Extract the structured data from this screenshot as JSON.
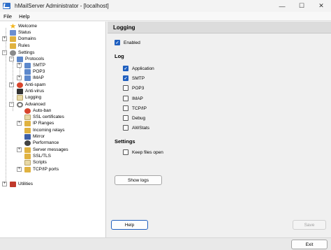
{
  "window": {
    "title": "hMailServer Administrator - [localhost]",
    "minimize": "—",
    "maximize": "☐",
    "close": "✕"
  },
  "menu": [
    "File",
    "Help"
  ],
  "tree": {
    "items": [
      {
        "label": "Welcome",
        "icon": "star-icon",
        "color": "#f2b51d"
      },
      {
        "label": "Status",
        "icon": "status-icon",
        "color": "#6c8fd0"
      },
      {
        "label": "Domains",
        "icon": "domains-icon",
        "color": "#e0b240"
      },
      {
        "label": "Rules",
        "icon": "rules-icon",
        "color": "#e0b240"
      },
      {
        "label": "Settings",
        "icon": "gear-icon",
        "color": "#8a8a8a"
      },
      {
        "label": "Protocols",
        "icon": "protocols-icon",
        "color": "#5c88cc"
      },
      {
        "label": "SMTP",
        "icon": "smtp-icon",
        "color": "#5c88cc"
      },
      {
        "label": "POP3",
        "icon": "pop3-icon",
        "color": "#5c88cc"
      },
      {
        "label": "IMAP",
        "icon": "imap-icon",
        "color": "#5c88cc"
      },
      {
        "label": "Anti-spam",
        "icon": "anti-spam-icon",
        "color": "#d8452c"
      },
      {
        "label": "Anti-virus",
        "icon": "anti-virus-icon",
        "color": "#333333"
      },
      {
        "label": "Logging",
        "icon": "logging-icon",
        "color": "#e8d9a6"
      },
      {
        "label": "Advanced",
        "icon": "magnifier-icon",
        "color": "#777777"
      },
      {
        "label": "Auto-ban",
        "icon": "auto-ban-icon",
        "color": "#d8452c"
      },
      {
        "label": "SSL certificates",
        "icon": "certificate-icon",
        "color": "#e8d9a6"
      },
      {
        "label": "IP Ranges",
        "icon": "ip-ranges-icon",
        "color": "#e0b240"
      },
      {
        "label": "Incoming relays",
        "icon": "relays-icon",
        "color": "#e0b240"
      },
      {
        "label": "Mirror",
        "icon": "mirror-icon",
        "color": "#3e5fa6"
      },
      {
        "label": "Performance",
        "icon": "performance-icon",
        "color": "#444444"
      },
      {
        "label": "Server messages",
        "icon": "messages-icon",
        "color": "#e0b240"
      },
      {
        "label": "SSL/TLS",
        "icon": "ssl-tls-icon",
        "color": "#e0b240"
      },
      {
        "label": "Scripts",
        "icon": "scripts-icon",
        "color": "#e8d9a6"
      },
      {
        "label": "TCP/IP ports",
        "icon": "ports-icon",
        "color": "#e0b240"
      },
      {
        "label": "Utilities",
        "icon": "utilities-icon",
        "color": "#c0392b"
      }
    ]
  },
  "pane": {
    "header": "Logging",
    "enabled_label": "Enabled",
    "log_section": "Log",
    "log_options": [
      {
        "label": "Application",
        "checked": true
      },
      {
        "label": "SMTP",
        "checked": true
      },
      {
        "label": "POP3",
        "checked": false
      },
      {
        "label": "IMAP",
        "checked": false
      },
      {
        "label": "TCP/IP",
        "checked": false
      },
      {
        "label": "Debug",
        "checked": false
      },
      {
        "label": "AWStats",
        "checked": false
      }
    ],
    "settings_section": "Settings",
    "keep_files_open_label": "Keep files open",
    "show_logs_button": "Show logs",
    "help_button": "Help",
    "save_button": "Save"
  },
  "exit_button": "Exit",
  "colors": {
    "accent": "#1f5fbf"
  }
}
